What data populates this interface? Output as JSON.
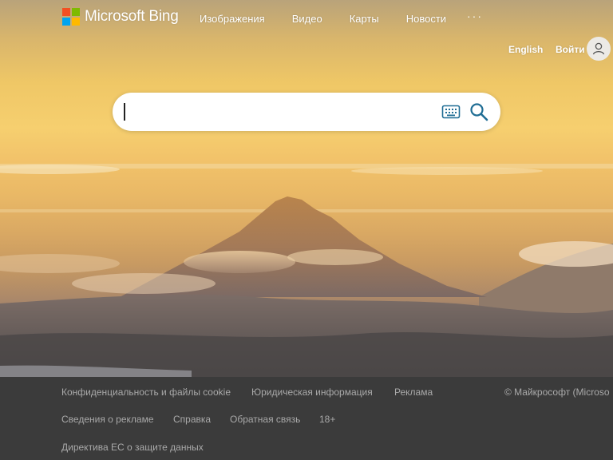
{
  "brand": {
    "name": "Microsoft Bing",
    "logo_colors": [
      "#f25022",
      "#7fba00",
      "#00a4ef",
      "#ffb900"
    ]
  },
  "nav": {
    "items": [
      {
        "label": "Изображения"
      },
      {
        "label": "Видео"
      },
      {
        "label": "Карты"
      },
      {
        "label": "Новости"
      }
    ],
    "more_label": "···"
  },
  "header": {
    "language_label": "English",
    "signin_label": "Войти"
  },
  "search": {
    "value": "",
    "placeholder": "",
    "accent_color": "#1f6d94"
  },
  "footer": {
    "row1": [
      "Конфиденциальность и файлы cookie",
      "Юридическая информация",
      "Реклама"
    ],
    "copyright": "© Майкрософт (Microso",
    "row2": [
      "Сведения о рекламе",
      "Справка",
      "Обратная связь",
      "18+"
    ],
    "row3": [
      "Директива ЕС о защите данных"
    ]
  },
  "icons": {
    "keyboard": "keyboard-icon",
    "search": "search-icon",
    "user": "user-icon",
    "more": "more-icon"
  }
}
